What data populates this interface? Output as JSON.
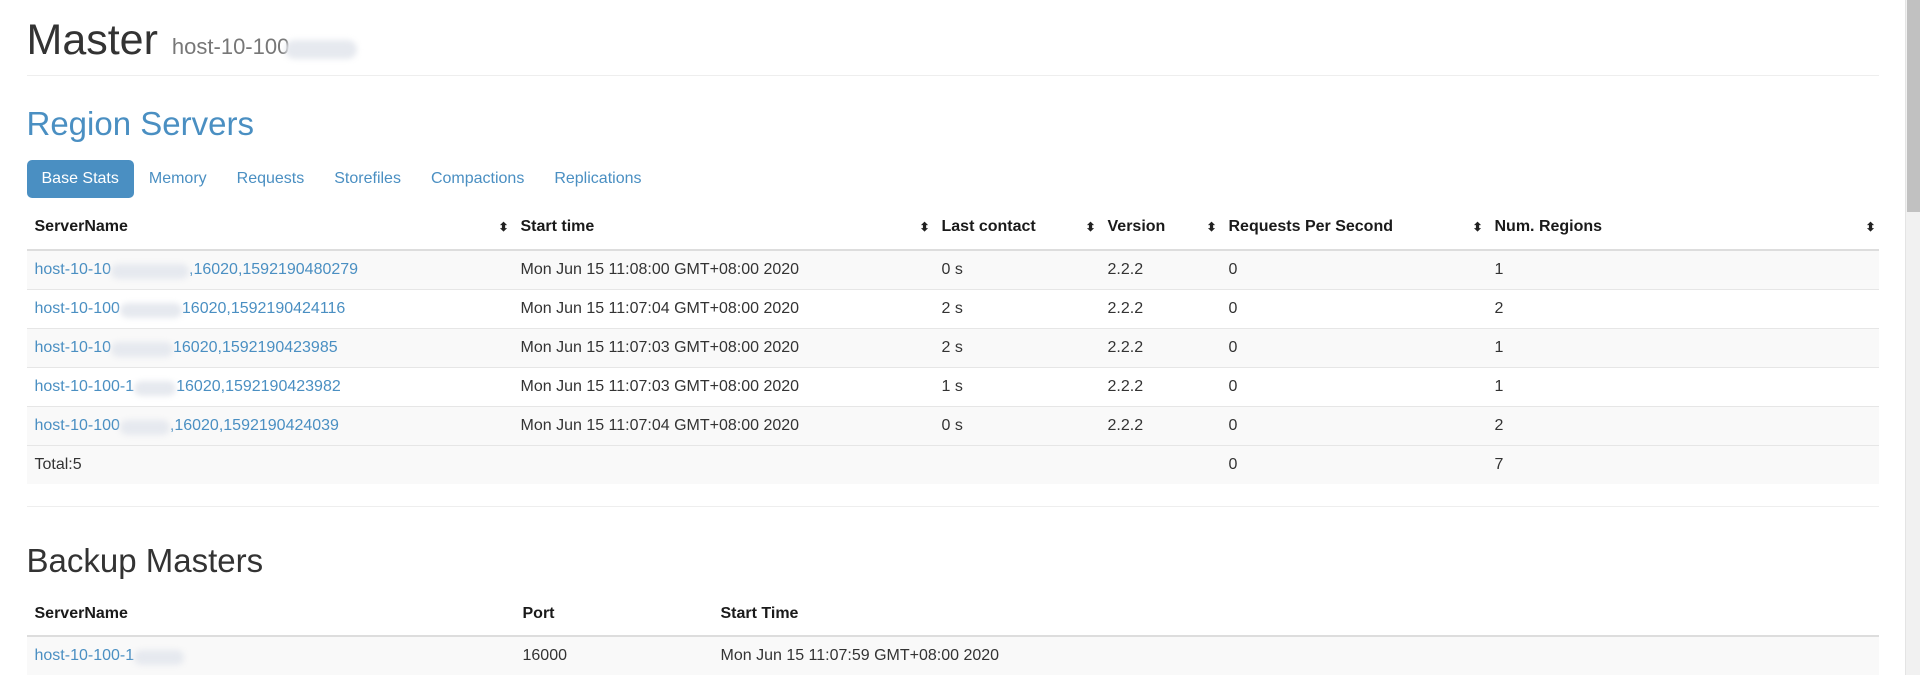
{
  "header": {
    "title": "Master",
    "hostname": "host-10-100",
    "hostname_redacted": true
  },
  "region_servers": {
    "section_title": "Region Servers",
    "tabs": [
      {
        "label": "Base Stats",
        "active": true
      },
      {
        "label": "Memory",
        "active": false
      },
      {
        "label": "Requests",
        "active": false
      },
      {
        "label": "Storefiles",
        "active": false
      },
      {
        "label": "Compactions",
        "active": false
      },
      {
        "label": "Replications",
        "active": false
      }
    ],
    "columns": [
      {
        "label": "ServerName",
        "sortable": true
      },
      {
        "label": "Start time",
        "sortable": true
      },
      {
        "label": "Last contact",
        "sortable": true
      },
      {
        "label": "Version",
        "sortable": true
      },
      {
        "label": "Requests Per Second",
        "sortable": true
      },
      {
        "label": "Num. Regions",
        "sortable": true
      }
    ],
    "rows": [
      {
        "server_prefix": "host-10-10",
        "server_suffix": ",16020,1592190480279",
        "redact_width": 78,
        "start_time": "Mon Jun 15 11:08:00 GMT+08:00 2020",
        "last_contact": "0 s",
        "version": "2.2.2",
        "requests_per_second": "0",
        "num_regions": "1"
      },
      {
        "server_prefix": "host-10-100",
        "server_suffix": "16020,1592190424116",
        "redact_width": 62,
        "start_time": "Mon Jun 15 11:07:04 GMT+08:00 2020",
        "last_contact": "2 s",
        "version": "2.2.2",
        "requests_per_second": "0",
        "num_regions": "2"
      },
      {
        "server_prefix": "host-10-10",
        "server_suffix": "16020,1592190423985",
        "redact_width": 62,
        "start_time": "Mon Jun 15 11:07:03 GMT+08:00 2020",
        "last_contact": "2 s",
        "version": "2.2.2",
        "requests_per_second": "0",
        "num_regions": "1"
      },
      {
        "server_prefix": "host-10-100-1",
        "server_suffix": "16020,1592190423982",
        "redact_width": 42,
        "start_time": "Mon Jun 15 11:07:03 GMT+08:00 2020",
        "last_contact": "1 s",
        "version": "2.2.2",
        "requests_per_second": "0",
        "num_regions": "1"
      },
      {
        "server_prefix": "host-10-100",
        "server_suffix": ",16020,1592190424039",
        "redact_width": 50,
        "start_time": "Mon Jun 15 11:07:04 GMT+08:00 2020",
        "last_contact": "0 s",
        "version": "2.2.2",
        "requests_per_second": "0",
        "num_regions": "2"
      }
    ],
    "total_row": {
      "label": "Total:5",
      "requests_per_second": "0",
      "num_regions": "7"
    }
  },
  "backup_masters": {
    "section_title": "Backup Masters",
    "columns": [
      {
        "label": "ServerName"
      },
      {
        "label": "Port"
      },
      {
        "label": "Start Time"
      }
    ],
    "rows": [
      {
        "server_prefix": "host-10-100-1",
        "redact_width": 50,
        "port": "16000",
        "start_time": "Mon Jun 15 11:07:59 GMT+08:00 2020"
      }
    ]
  },
  "icons": {
    "sort": "⬍"
  },
  "colors": {
    "accent": "#4a8fc2",
    "text": "#333333",
    "header_text": "#1a1a1a",
    "stripe": "#f9f9f9",
    "border": "#e6e6e6",
    "scrollbar_track": "#f1f1f1",
    "scrollbar_thumb": "#c1c1c1"
  }
}
